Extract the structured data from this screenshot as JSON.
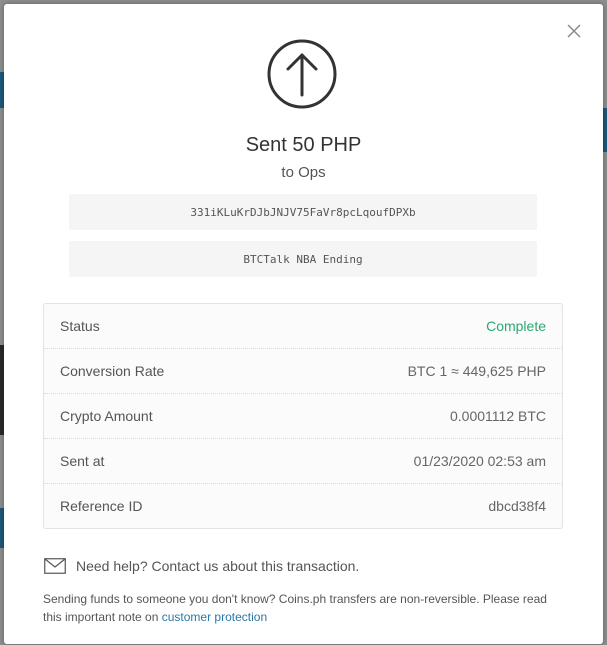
{
  "modal": {
    "title": "Sent 50 PHP",
    "subtitle": "to Ops",
    "address": "331iKLuKrDJbJNJV75FaVr8pcLqoufDPXb",
    "memo": "BTCTalk NBA Ending"
  },
  "details": [
    {
      "label": "Status",
      "value": "Complete"
    },
    {
      "label": "Conversion Rate",
      "value": "BTC 1 ≈ 449,625 PHP"
    },
    {
      "label": "Crypto Amount",
      "value": "0.0001112 BTC"
    },
    {
      "label": "Sent at",
      "value": "01/23/2020 02:53 am"
    },
    {
      "label": "Reference ID",
      "value": "dbcd38f4"
    }
  ],
  "help": {
    "text": "Need help? Contact us about this transaction."
  },
  "note": {
    "text": "Sending funds to someone you don't know? Coins.ph transfers are non-reversible. Please read this important note on ",
    "link": "customer protection"
  },
  "icons": {
    "close": "close-icon",
    "sent": "arrow-up-circle-icon",
    "help": "mail-icon"
  },
  "colors": {
    "status_complete": "#2aa873",
    "link": "#2b78a8"
  }
}
